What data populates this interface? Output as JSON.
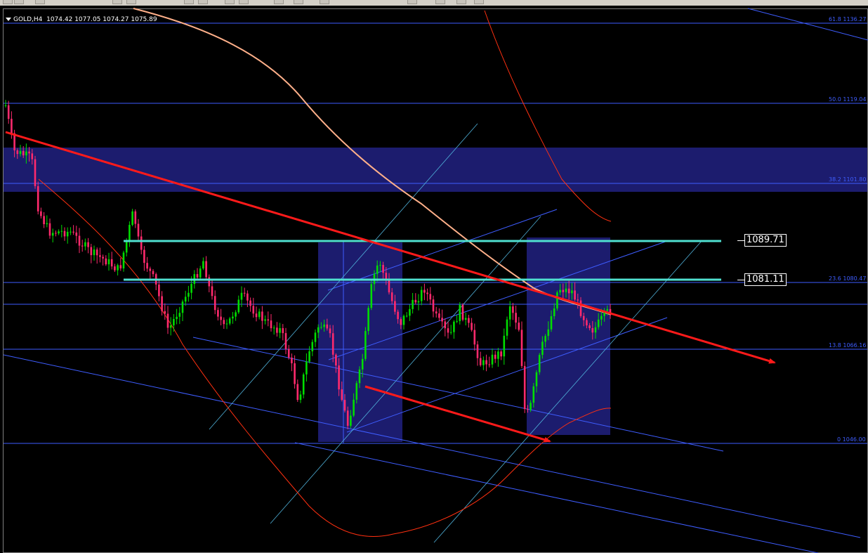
{
  "symbol_header": {
    "symbol": "GOLD,H4",
    "open": "1074.42",
    "high": "1077.05",
    "low": "1074.27",
    "close": "1075.89"
  },
  "fib_levels": [
    {
      "label": "61.8 1136.27"
    },
    {
      "label": "50.0 1119.04"
    },
    {
      "label": "38.2 1101.80"
    },
    {
      "label": "23.6 1080.47"
    },
    {
      "label": "13.8 1066.16"
    },
    {
      "label": "0 1046.00"
    }
  ],
  "price_marks": [
    {
      "label": "1089.71"
    },
    {
      "label": "1081.11"
    }
  ],
  "colors": {
    "background": "#000000",
    "bull_candle": "#00dd00",
    "bear_candle": "#ff2a6d",
    "fib_line": "#3e5dff",
    "zone": "#1c1c6e",
    "trend_red": "#ff1a1a",
    "resistance": "#4fe0d0",
    "ma_long": "#ffb08a",
    "ma_short": "#ff3010"
  },
  "icons": [
    "toolbar-button-icon"
  ]
}
